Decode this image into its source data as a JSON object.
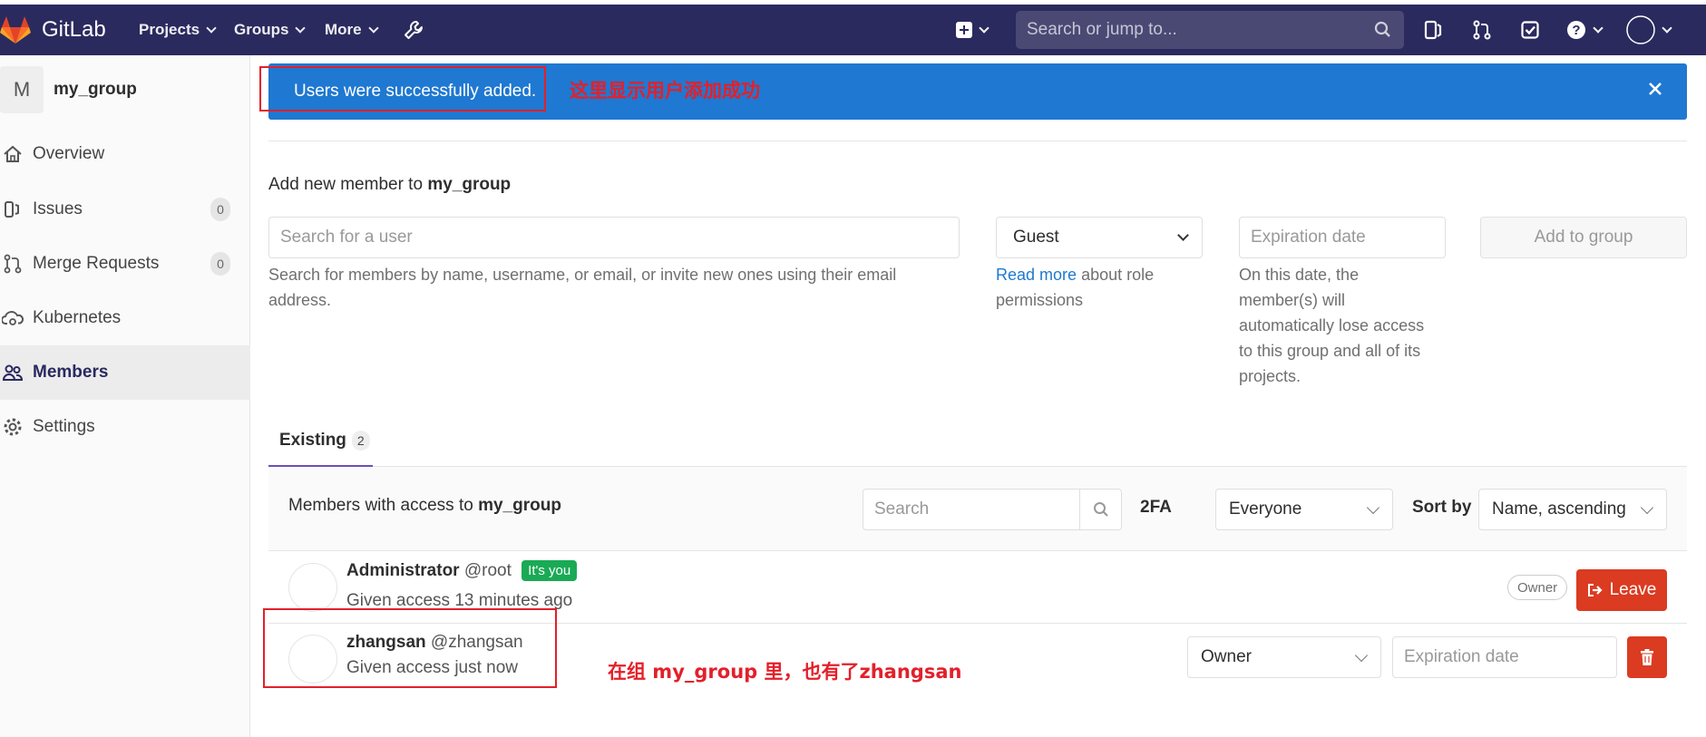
{
  "navbar": {
    "brand": "GitLab",
    "projects": "Projects",
    "groups": "Groups",
    "more": "More",
    "search_placeholder": "Search or jump to..."
  },
  "sidebar": {
    "group_initial": "M",
    "group_name": "my_group",
    "items": [
      {
        "label": "Overview"
      },
      {
        "label": "Issues",
        "count": "0"
      },
      {
        "label": "Merge Requests",
        "count": "0"
      },
      {
        "label": "Kubernetes"
      },
      {
        "label": "Members"
      },
      {
        "label": "Settings"
      }
    ]
  },
  "flash": {
    "message": "Users were successfully added."
  },
  "annotations": {
    "flash_note": "这里显示用户添加成功",
    "member_note": "在组 my_group 里，也有了zhangsan"
  },
  "add_member": {
    "title_prefix": "Add new member to",
    "group": "my_group",
    "search_placeholder": "Search for a user",
    "search_help": "Search for members by name, username, or email, or invite new ones using their email address.",
    "role_value": "Guest",
    "role_link": "Read more",
    "role_help": "about role permissions",
    "expiration_placeholder": "Expiration date",
    "expiration_help": "On this date, the member(s) will automatically lose access to this group and all of its projects.",
    "add_button": "Add to group"
  },
  "tabs": {
    "existing_label": "Existing",
    "existing_count": "2"
  },
  "members_header": {
    "title_prefix": "Members with access to",
    "group": "my_group",
    "search_placeholder": "Search",
    "twofa_label": "2FA",
    "twofa_value": "Everyone",
    "sort_label": "Sort by",
    "sort_value": "Name, ascending"
  },
  "members": [
    {
      "name": "Administrator",
      "username": "@root",
      "badge": "It's you",
      "access": "Given access 13 minutes ago",
      "role": "Owner",
      "action": "Leave"
    },
    {
      "name": "zhangsan",
      "username": "@zhangsan",
      "access": "Given access just now",
      "role": "Owner",
      "expiration_placeholder": "Expiration date"
    }
  ]
}
